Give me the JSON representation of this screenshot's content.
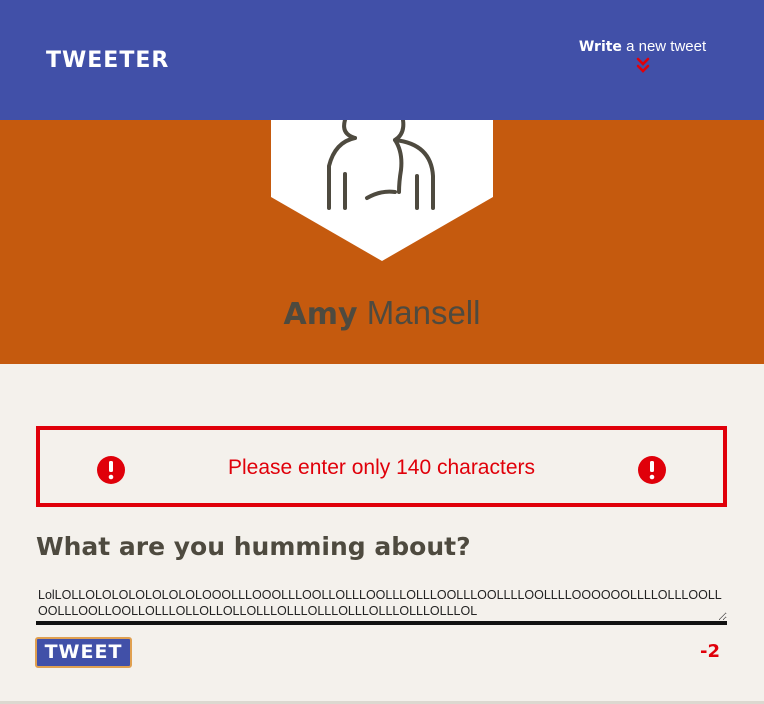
{
  "header": {
    "logo": "TWEETER",
    "compose_toggle": {
      "strong": "Write",
      "rest": " a new tweet",
      "icon": "double-chevron-down-icon"
    }
  },
  "profile": {
    "first_name": "Amy",
    "last_name": "Mansell",
    "avatar_icon": "user-avatar-icon"
  },
  "error": {
    "message": "Please enter only 140 characters",
    "icon": "exclamation-circle-icon"
  },
  "compose": {
    "heading": "What are you humming about?",
    "tweet_text": "LolLOLLOLOLOLOLOLOLOLOOOLLLOOOLLLOOLLOLLLOOLLLOLLLOOLLLOOLLLLOOLLLLOOOOOOLLLLOLLLOOLLOOLLLOOLLOOLLOLLLOLLOLLOLLOLLLOLLLOLLLOLLLOLLLOLLLOLLLOL",
    "submit_label": "TWEET",
    "char_counter": "-2"
  },
  "colors": {
    "nav": "#4150a8",
    "hero": "#c55a0e",
    "error": "#e0000a",
    "background": "#f4f1ec",
    "text": "#4e4a3f"
  }
}
